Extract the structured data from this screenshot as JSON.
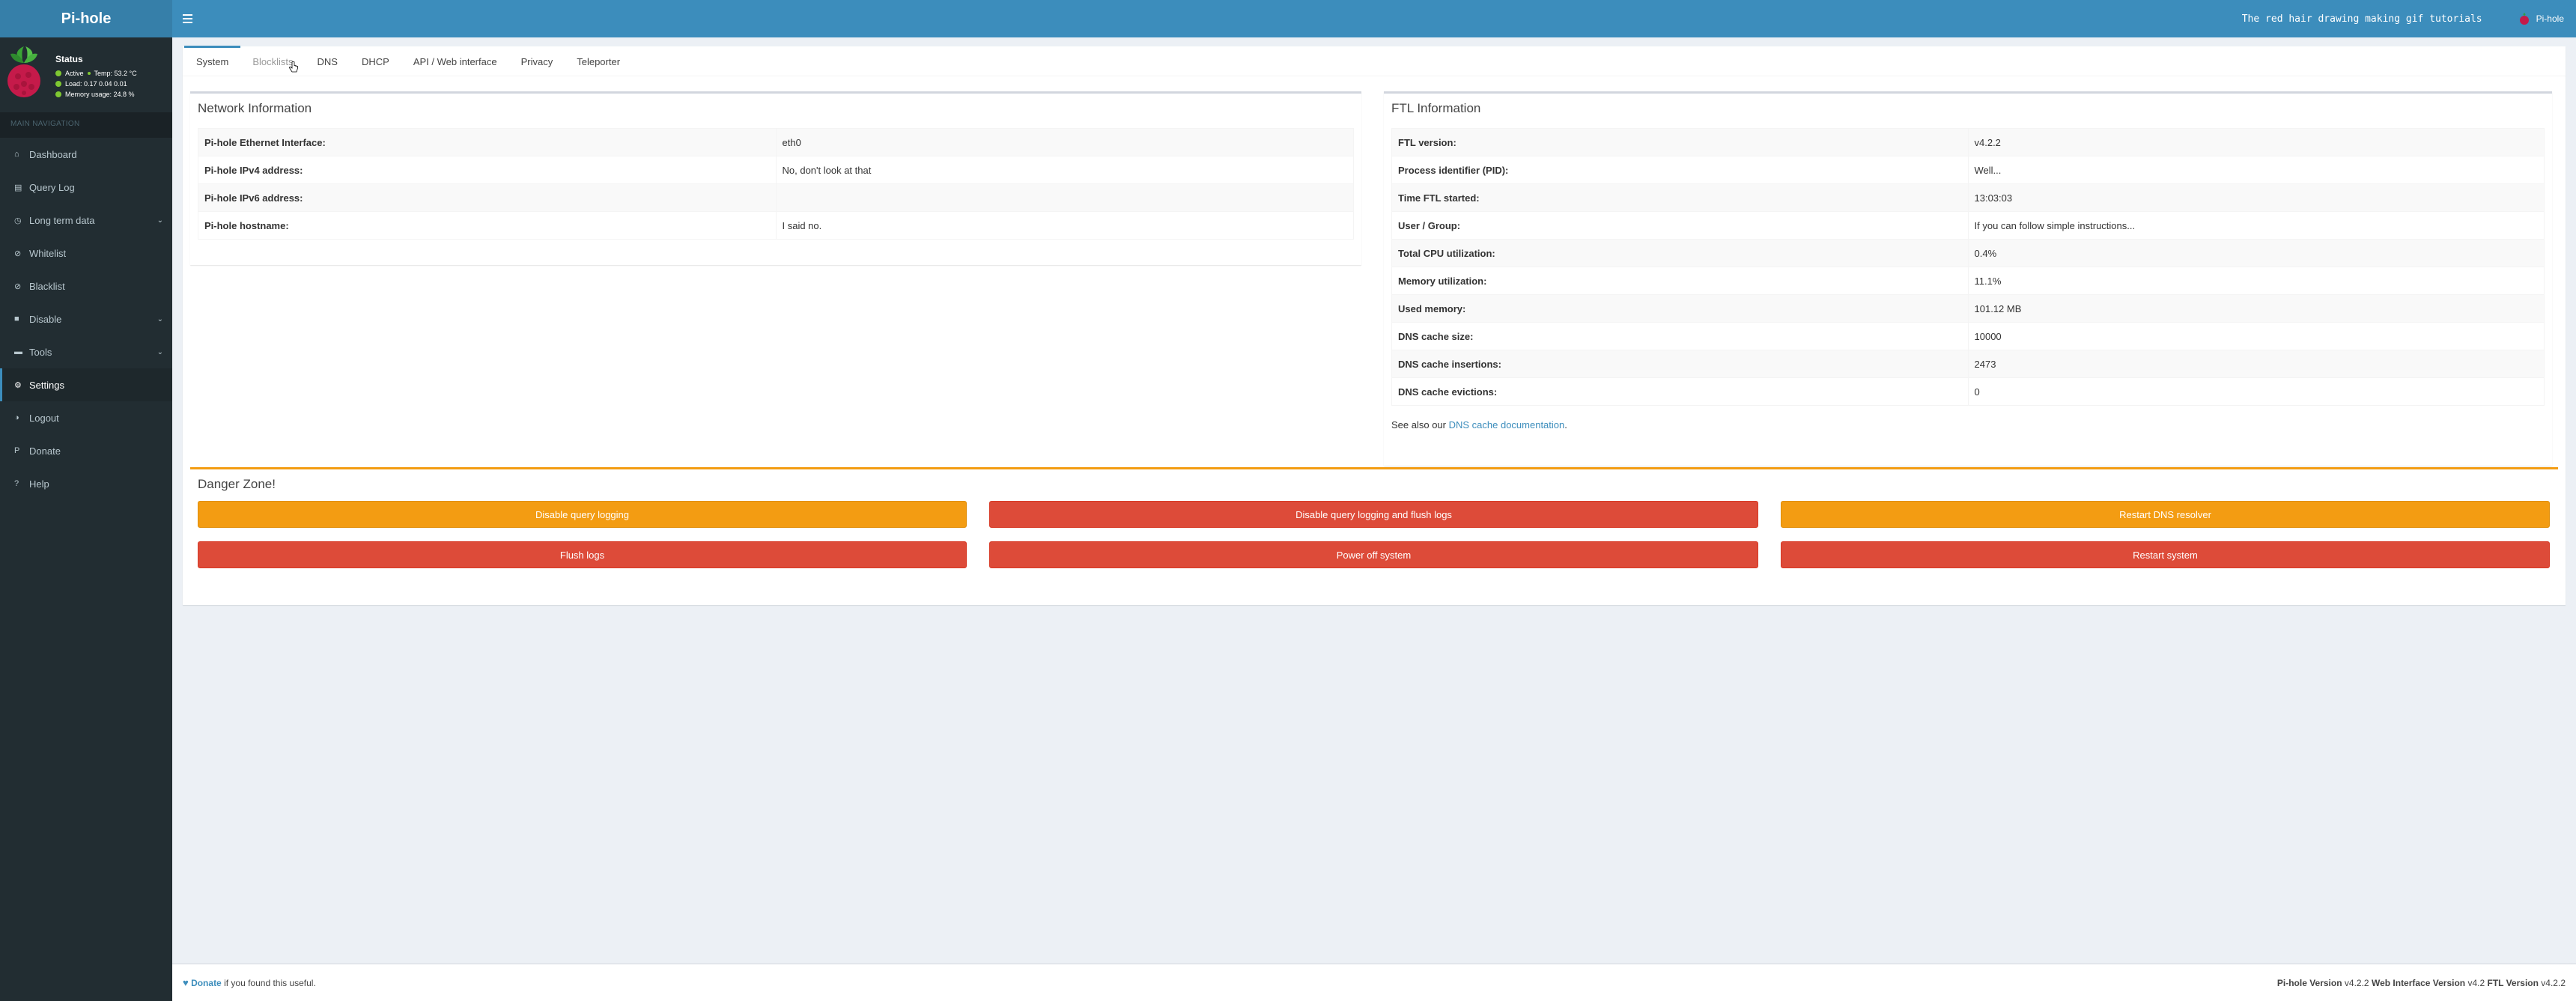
{
  "app": {
    "logo": "Pi-hole"
  },
  "header": {
    "hostname_text": "The red hair drawing making gif tutorials",
    "user_label": "Pi-hole"
  },
  "status": {
    "title": "Status",
    "active": "Active",
    "temp": "Temp: 53.2 °C",
    "load": "Load:  0.17  0.04  0.01",
    "memory": "Memory usage:  24.8 %",
    "dot_color": "#7fc832"
  },
  "sidebar": {
    "section": "MAIN NAVIGATION",
    "items": [
      {
        "label": "Dashboard",
        "icon": "home-icon",
        "glyph": "⌂"
      },
      {
        "label": "Query Log",
        "icon": "file-icon",
        "glyph": "▤"
      },
      {
        "label": "Long term data",
        "icon": "clock-icon",
        "glyph": "◷"
      },
      {
        "label": "Whitelist",
        "icon": "check-circle-icon",
        "glyph": "⊘"
      },
      {
        "label": "Blacklist",
        "icon": "ban-icon",
        "glyph": "⊘"
      },
      {
        "label": "Disable",
        "icon": "stop-icon",
        "glyph": "■"
      },
      {
        "label": "Tools",
        "icon": "folder-icon",
        "glyph": "▬"
      },
      {
        "label": "Settings",
        "icon": "cogs-icon",
        "glyph": "⚙"
      },
      {
        "label": "Logout",
        "icon": "user-times-icon",
        "glyph": "◑"
      },
      {
        "label": "Donate",
        "icon": "paypal-icon",
        "glyph": "P"
      },
      {
        "label": "Help",
        "icon": "question-circle-icon",
        "glyph": "?"
      }
    ],
    "chevron": "⌄"
  },
  "tabs": [
    "System",
    "Blocklists",
    "DNS",
    "DHCP",
    "API / Web interface",
    "Privacy",
    "Teleporter"
  ],
  "network": {
    "title": "Network Information",
    "rows": [
      {
        "k": "Pi-hole Ethernet Interface:",
        "v": "eth0"
      },
      {
        "k": "Pi-hole IPv4 address:",
        "v": "No, don't look at that"
      },
      {
        "k": "Pi-hole IPv6 address:",
        "v": ""
      },
      {
        "k": "Pi-hole hostname:",
        "v": "I said no."
      }
    ]
  },
  "ftl": {
    "title": "FTL Information",
    "rows": [
      {
        "k": "FTL version:",
        "v": "v4.2.2"
      },
      {
        "k": "Process identifier (PID):",
        "v": "Well..."
      },
      {
        "k": "Time FTL started:",
        "v": "13:03:03"
      },
      {
        "k": "User / Group:",
        "v": "If you can follow simple instructions..."
      },
      {
        "k": "Total CPU utilization:",
        "v": "0.4%"
      },
      {
        "k": "Memory utilization:",
        "v": "11.1%"
      },
      {
        "k": "Used memory:",
        "v": "101.12 MB"
      },
      {
        "k": "DNS cache size:",
        "v": "10000"
      },
      {
        "k": "DNS cache insertions:",
        "v": "2473"
      },
      {
        "k": "DNS cache evictions:",
        "v": "0"
      }
    ],
    "see_also_prefix": "See also our ",
    "see_also_link": "DNS cache documentation",
    "see_also_suffix": "."
  },
  "danger": {
    "title": "Danger Zone!",
    "buttons": [
      {
        "label": "Disable query logging",
        "style": "warning"
      },
      {
        "label": "Disable query logging and flush logs",
        "style": "danger"
      },
      {
        "label": "Restart DNS resolver",
        "style": "warning"
      },
      {
        "label": "Flush logs",
        "style": "danger"
      },
      {
        "label": "Power off system",
        "style": "danger"
      },
      {
        "label": "Restart system",
        "style": "danger"
      }
    ]
  },
  "footer": {
    "donate": "Donate",
    "donate_suffix": " if you found this useful.",
    "pihole_label": "Pi-hole Version",
    "pihole_version": "v4.2.2",
    "web_label": "Web Interface Version",
    "web_version": "v4.2",
    "ftl_label": "FTL Version",
    "ftl_version": "v4.2.2"
  },
  "colors": {
    "header_blue": "#3c8dbc",
    "logo_blue": "#367fa9",
    "sidebar_dark": "#222d32",
    "warning": "#f39c12",
    "danger": "#dd4b39"
  }
}
